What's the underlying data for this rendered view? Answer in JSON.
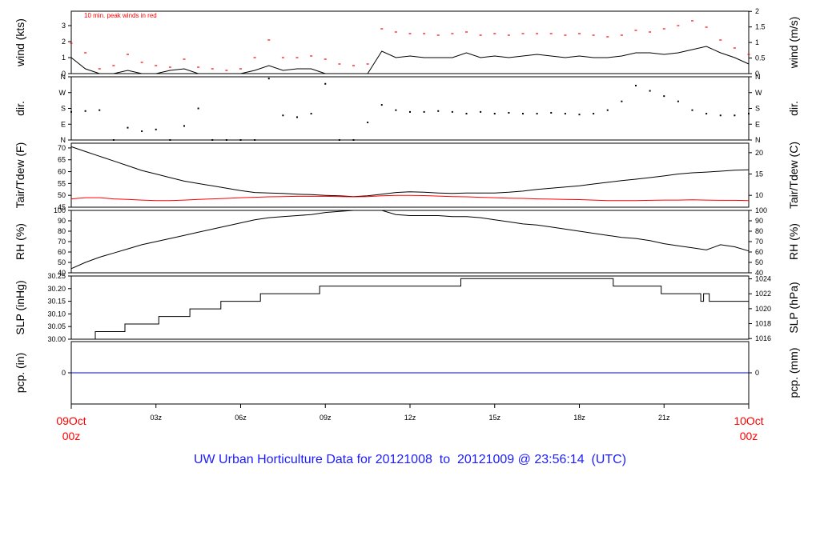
{
  "footer_title": "UW Urban Horticulture Data for 20121008  to  20121009 @ 23:56:14  (UTC)",
  "colors": {
    "primary": "#000000",
    "peak": "#ff0000",
    "pcp": "#0000ff",
    "title": "#1c1cff"
  },
  "start_date": {
    "day": "09Oct",
    "hour": "00z"
  },
  "end_date": {
    "day": "10Oct",
    "hour": "00z"
  },
  "x_ticks": [
    "03z",
    "06z",
    "09z",
    "12z",
    "15z",
    "18z",
    "21z"
  ],
  "chart_data": [
    {
      "type": "line",
      "ylabel": "wind (kts)",
      "ylabel_right": "wind (m/s)",
      "annotation": "10 min. peak winds in red",
      "ylim": [
        0,
        3.9
      ],
      "yticks": [
        "0",
        "1",
        "2",
        "3"
      ],
      "yticks_right": [
        "0",
        "0.5",
        "1",
        "1.5",
        "2"
      ],
      "x": [
        0,
        0.5,
        1,
        1.5,
        2,
        2.5,
        3,
        3.5,
        4,
        4.5,
        5,
        5.5,
        6,
        6.5,
        7,
        7.5,
        8,
        8.5,
        9,
        9.5,
        10,
        10.5,
        11,
        11.5,
        12,
        12.5,
        13,
        13.5,
        14,
        14.5,
        15,
        15.5,
        16,
        16.5,
        17,
        17.5,
        18,
        18.5,
        19,
        19.5,
        20,
        20.5,
        21,
        21.5,
        22,
        22.5,
        23,
        23.5,
        24
      ],
      "series": [
        {
          "values": [
            1.0,
            0.3,
            0,
            0,
            0.2,
            0,
            0,
            0.2,
            0.3,
            0,
            0,
            0,
            0,
            0.2,
            0.5,
            0.2,
            0.3,
            0.3,
            0,
            0,
            0,
            0,
            1.4,
            1.0,
            1.1,
            1.0,
            1.0,
            1.0,
            1.3,
            1.0,
            1.1,
            1.0,
            1.1,
            1.2,
            1.1,
            1.0,
            1.1,
            1.0,
            1.0,
            1.1,
            1.3,
            1.3,
            1.2,
            1.3,
            1.5,
            1.7,
            1.3,
            1.0,
            0.6
          ]
        },
        {
          "values": [
            1.9,
            1.3,
            0.3,
            0.5,
            1.2,
            0.7,
            0.5,
            0.4,
            0.9,
            0.4,
            0.3,
            0.2,
            0.3,
            1.0,
            2.1,
            1.0,
            1.0,
            1.1,
            0.9,
            0.6,
            0.5,
            0.6,
            2.8,
            2.6,
            2.5,
            2.5,
            2.4,
            2.5,
            2.6,
            2.4,
            2.5,
            2.4,
            2.5,
            2.5,
            2.5,
            2.4,
            2.5,
            2.4,
            2.3,
            2.4,
            2.7,
            2.6,
            2.8,
            3.0,
            3.3,
            2.9,
            2.1,
            1.6,
            1.2
          ]
        }
      ]
    },
    {
      "type": "scatter",
      "ylabel": "dir.",
      "ylabel_right": "dir.",
      "yticks": [
        "N",
        "E",
        "S",
        "W",
        "N"
      ],
      "x": [
        0,
        0.5,
        1,
        1.5,
        2,
        2.5,
        3,
        3.5,
        4,
        4.5,
        5,
        5.5,
        6,
        6.5,
        7,
        7.5,
        8,
        8.5,
        9,
        9.5,
        10,
        10.5,
        11,
        11.5,
        12,
        12.5,
        13,
        13.5,
        14,
        14.5,
        15,
        15.5,
        16,
        16.5,
        17,
        17.5,
        18,
        18.5,
        19,
        19.5,
        20,
        20.5,
        21,
        21.5,
        22,
        22.5,
        23,
        23.5,
        24
      ],
      "values": [
        160,
        165,
        170,
        0,
        70,
        50,
        60,
        0,
        80,
        180,
        0,
        0,
        0,
        0,
        350,
        140,
        130,
        150,
        320,
        0,
        0,
        100,
        200,
        170,
        160,
        160,
        165,
        160,
        150,
        160,
        150,
        155,
        150,
        150,
        155,
        150,
        145,
        150,
        170,
        220,
        310,
        280,
        250,
        220,
        170,
        150,
        140,
        140,
        150
      ]
    },
    {
      "type": "line",
      "ylabel": "Tair/Tdew (F)",
      "ylabel_right": "Tair/Tdew (C)",
      "ylim": [
        45,
        72
      ],
      "yticks": [
        "45",
        "50",
        "55",
        "60",
        "65",
        "70"
      ],
      "yticks_right": [
        "10",
        "15",
        "20"
      ],
      "x": [
        0,
        0.5,
        1,
        1.5,
        2,
        2.5,
        3,
        3.5,
        4,
        4.5,
        5,
        5.5,
        6,
        6.5,
        7,
        7.5,
        8,
        8.5,
        9,
        9.5,
        10,
        10.5,
        11,
        11.5,
        12,
        12.5,
        13,
        13.5,
        14,
        14.5,
        15,
        15.5,
        16,
        16.5,
        17,
        17.5,
        18,
        18.5,
        19,
        19.5,
        20,
        20.5,
        21,
        21.5,
        22,
        22.5,
        23,
        23.5,
        24
      ],
      "series": [
        {
          "values": [
            70.5,
            68.5,
            66.5,
            64.5,
            62.5,
            60.5,
            59.0,
            57.5,
            56.0,
            55.0,
            54.0,
            53.0,
            52.0,
            51.2,
            51.0,
            50.8,
            50.5,
            50.3,
            50.0,
            49.8,
            49.5,
            49.8,
            50.5,
            51.2,
            51.5,
            51.3,
            51.0,
            50.8,
            51.0,
            51.0,
            51.0,
            51.3,
            51.8,
            52.5,
            53.0,
            53.5,
            54.0,
            54.8,
            55.5,
            56.2,
            56.8,
            57.5,
            58.2,
            59.0,
            59.5,
            59.8,
            60.2,
            60.6,
            60.8
          ]
        },
        {
          "values": [
            48.5,
            49.0,
            49.0,
            48.5,
            48.3,
            48.0,
            47.8,
            47.8,
            48.0,
            48.3,
            48.5,
            48.7,
            49.0,
            49.2,
            49.4,
            49.5,
            49.6,
            49.6,
            49.6,
            49.5,
            49.4,
            49.5,
            49.8,
            50.0,
            50.0,
            49.9,
            49.7,
            49.5,
            49.4,
            49.2,
            49.0,
            48.8,
            48.7,
            48.5,
            48.4,
            48.3,
            48.2,
            48.0,
            47.8,
            47.8,
            47.8,
            47.9,
            48.0,
            48.0,
            48.1,
            48.0,
            47.9,
            47.9,
            47.8
          ]
        }
      ]
    },
    {
      "type": "line",
      "ylabel": "RH (%)",
      "ylabel_right": "RH (%)",
      "ylim": [
        40,
        100
      ],
      "yticks": [
        "40",
        "50",
        "60",
        "70",
        "80",
        "90",
        "100"
      ],
      "x": [
        0,
        0.5,
        1,
        1.5,
        2,
        2.5,
        3,
        3.5,
        4,
        4.5,
        5,
        5.5,
        6,
        6.5,
        7,
        7.5,
        8,
        8.5,
        9,
        9.5,
        10,
        10.5,
        11,
        11.5,
        12,
        12.5,
        13,
        13.5,
        14,
        14.5,
        15,
        15.5,
        16,
        16.5,
        17,
        17.5,
        18,
        18.5,
        19,
        19.5,
        20,
        20.5,
        21,
        21.5,
        22,
        22.5,
        23,
        23.5,
        24
      ],
      "values": [
        44,
        50,
        55,
        59,
        63,
        67,
        70,
        73,
        76,
        79,
        82,
        85,
        88,
        91,
        93,
        94,
        95,
        96,
        98,
        99,
        100,
        100,
        100,
        96,
        95,
        95,
        95,
        94,
        94,
        93,
        91,
        89,
        87,
        86,
        84,
        82,
        80,
        78,
        76,
        74,
        73,
        71,
        68,
        66,
        64,
        62,
        67,
        65,
        61
      ]
    },
    {
      "type": "line",
      "ylabel": "SLP (inHg)",
      "ylabel_right": "SLP (hPa)",
      "ylim": [
        30.0,
        30.25
      ],
      "yticks": [
        "30.00",
        "30.05",
        "30.10",
        "30.15",
        "30.20",
        "30.25"
      ],
      "yticks_right": [
        "1016",
        "1018",
        "1020",
        "1022",
        "1024"
      ],
      "x": [
        0,
        0.85,
        1.9,
        3.1,
        4.2,
        5.3,
        6.7,
        8.8,
        13.8,
        19.2,
        20.9,
        22.3,
        22.4,
        22.5,
        22.6,
        24
      ],
      "values": [
        30.0,
        30.03,
        30.06,
        30.09,
        30.12,
        30.15,
        30.18,
        30.21,
        30.24,
        30.21,
        30.18,
        30.15,
        30.18,
        30.18,
        30.15,
        30.15
      ]
    },
    {
      "type": "line",
      "ylabel": "pcp. (in)",
      "ylabel_right": "pcp. (mm)",
      "ylim": [
        -1,
        1
      ],
      "yticks": [
        "0"
      ],
      "yticks_right": [
        "0"
      ],
      "x": [
        0,
        24
      ],
      "values": [
        0,
        0
      ]
    }
  ]
}
